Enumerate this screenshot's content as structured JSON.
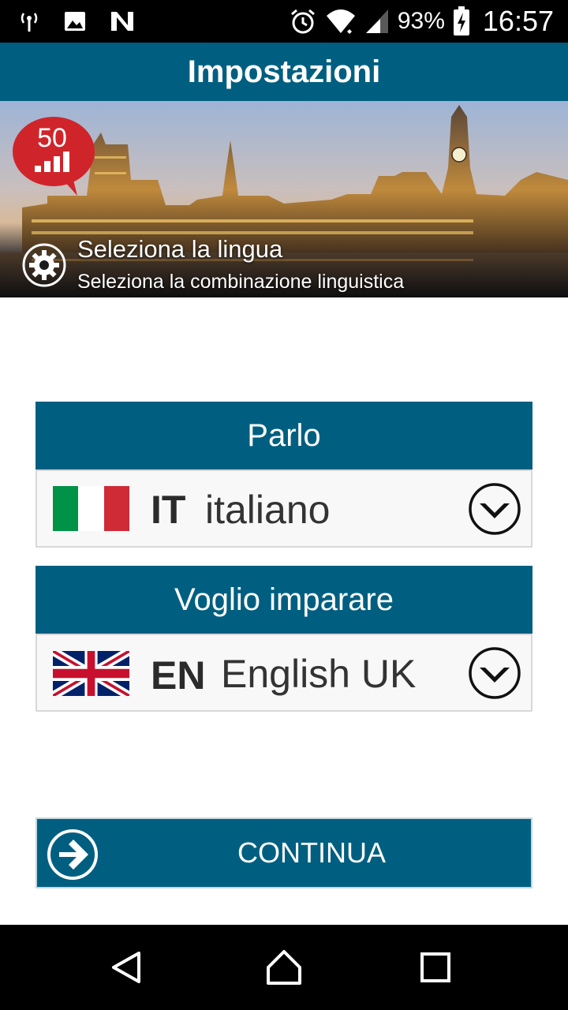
{
  "status_bar": {
    "battery_percent": "93%",
    "time": "16:57",
    "icons": [
      "antenna-icon",
      "image-icon",
      "n-app-icon",
      "alarm-icon",
      "wifi-icon",
      "signal-icon",
      "battery-charging-icon"
    ]
  },
  "app_bar": {
    "title": "Impostazioni"
  },
  "banner": {
    "logo_number": "50",
    "heading": "Seleziona la lingua",
    "subheading": "Seleziona la combinazione linguistica"
  },
  "speak": {
    "header": "Parlo",
    "code": "IT",
    "language": "italiano",
    "flag": "italy-flag"
  },
  "learn": {
    "header": "Voglio imparare",
    "code": "EN",
    "language": "English UK",
    "flag": "uk-flag"
  },
  "continue_button": {
    "label": "CONTINUA"
  },
  "colors": {
    "primary": "#005f80",
    "row_background": "#f8f8f8",
    "logo_red": "#d0242b",
    "italy_green": "#009246",
    "italy_red": "#ce2b37",
    "uk_blue": "#012169",
    "uk_red": "#c8102e"
  }
}
